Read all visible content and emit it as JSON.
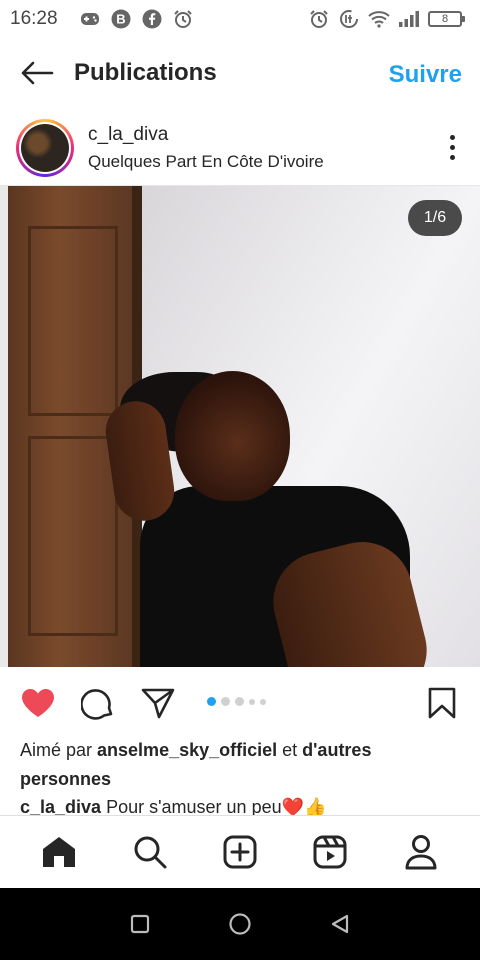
{
  "status_bar": {
    "time": "16:28",
    "battery": "8",
    "left_icons": [
      "gamepad-icon",
      "b-app-icon",
      "facebook-icon",
      "alarm-icon"
    ],
    "right_icons": [
      "alarm-icon",
      "data-saver-icon",
      "wifi-icon",
      "signal-icon",
      "battery-icon"
    ]
  },
  "header": {
    "title": "Publications",
    "follow_label": "Suivre"
  },
  "post": {
    "username": "c_la_diva",
    "location": "Quelques Part En Côte D'ivoire",
    "image_counter": "1/6",
    "carousel_active_index": 0,
    "carousel_dots": 5
  },
  "likes": {
    "prefix": "Aimé par ",
    "user": "anselme_sky_officiel",
    "middle": " et ",
    "others": "d'autres personnes"
  },
  "caption": {
    "user": "c_la_diva",
    "text": " Pour s'amuser un peu",
    "emoji": "❤️👍"
  },
  "tabbar": [
    "home-icon",
    "search-icon",
    "create-icon",
    "reels-icon",
    "profile-icon"
  ],
  "navbar": [
    "recents-button",
    "home-button",
    "back-button"
  ],
  "colors": {
    "accent": "#1ea1f1",
    "like": "#ed4956",
    "text": "#262626"
  }
}
